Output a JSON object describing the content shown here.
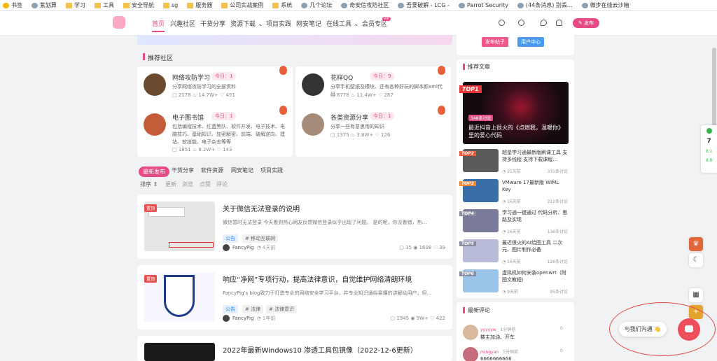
{
  "bookmarks": [
    {
      "icon": "star-icon",
      "label": "书签"
    },
    {
      "icon": "globe-icon",
      "label": "紫划算"
    },
    {
      "icon": "folder-icon",
      "label": "学习"
    },
    {
      "icon": "folder-icon",
      "label": "工具"
    },
    {
      "icon": "folder-icon",
      "label": "安全导航"
    },
    {
      "icon": "folder-icon",
      "label": "sg"
    },
    {
      "icon": "folder-icon",
      "label": "服务器"
    },
    {
      "icon": "folder-icon",
      "label": "公司实战案例"
    },
    {
      "icon": "folder-icon",
      "label": "系统"
    },
    {
      "icon": "globe-icon",
      "label": "几个论坛"
    },
    {
      "icon": "globe-icon",
      "label": "奇安信攻防社区"
    },
    {
      "icon": "globe-icon",
      "label": "吾爱破解 - LCG -"
    },
    {
      "icon": "globe-icon",
      "label": "Parrot Security"
    },
    {
      "icon": "globe-icon",
      "label": "(44条消息) 别丢..."
    },
    {
      "icon": "globe-icon",
      "label": "微步在线云沙箱"
    }
  ],
  "nav": {
    "items": [
      "首页",
      "兴趣社区",
      "干货分享",
      "资源下载 ⌄",
      "项目实践",
      "网安笔记",
      "在线工具 ⌄",
      "会员专区"
    ],
    "vip_badge": "VIP",
    "publish": "✎ 发布"
  },
  "side_top": {
    "publish_post": "发布帖子",
    "user_center": "用户中心"
  },
  "community": {
    "title": "推荐社区",
    "cards": [
      {
        "name": "网络攻防学习",
        "today": "今日：1",
        "desc": "分享网络攻防学习的全部资料",
        "stats": "▢ 2178   ♨ 14.7W+   ♡ 451",
        "color": "#6b4a2f"
      },
      {
        "name": "花样QQ",
        "today": "今日：9",
        "desc": "分享手机壁纸及模块、还有各种好玩的脚本颜xml代码",
        "stats": "▢ 8778   ♨ 11.4W+   ♡ 287",
        "color": "#333"
      },
      {
        "name": "电子图书馆",
        "today": "今日：1",
        "desc": "包括编程技术、红蓝黑队、软件开发、电子技术、电脑技巧、基础知识、加密解密、前端、破解逆向、建站、软技能、电子杂志等等",
        "stats": "▢ 1851   ♨ 8.2W+   ♡ 143",
        "color": "#c45c3a"
      },
      {
        "name": "各类资源分享",
        "today": "今日：1",
        "desc": "分享一些有意思用的知识",
        "stats": "▢ 1375   ♨ 3.8W+   ♡ 126",
        "color": "#a58b7a"
      }
    ]
  },
  "tabs": [
    "最新发布",
    "干货分享",
    "软件资源",
    "网安笔记",
    "项目实践"
  ],
  "sort": [
    "排序 ⇕",
    "更新",
    "浏览",
    "点赞",
    "评论"
  ],
  "posts": [
    {
      "tag": "置顶",
      "title": "关于微信无法登录的说明",
      "excerpt": "微信暂时无法登录 今天看到热心网友反馈微信登录似乎出现了问题。 是的呢，你没看错，热…",
      "tags": [
        "公告",
        "# 移动互联网"
      ],
      "author": "FancyPig",
      "time": "◔ 4天前",
      "stats": "▢ 35   ◉ 1608   ♡ 39"
    },
    {
      "tag": "置顶",
      "title": "响应“净网”专项行动，提高法律意识，自觉维护网络清朗环境",
      "excerpt": "FancyPig's blog致力于打造专业的网络安全学习平台，并专业知识通俗易懂的讲解给用户，但…",
      "tags": [
        "公告",
        "# 法律",
        "# 法律意识"
      ],
      "author": "FancyPig",
      "time": "◔ 1年前",
      "stats": "▢ 1945   ◉ 9W+   ♡ 422"
    },
    {
      "tag": "",
      "title": "2022年最新Windows10 渗透工具包镜像（2022-12-6更新）",
      "excerpt": "",
      "tags": [],
      "author": "",
      "time": "",
      "stats": ""
    }
  ],
  "articles": {
    "title": "推荐文章",
    "top1": {
      "rank": "TOP1",
      "hot": "348条讨论",
      "title": "最近抖音上很火的《点燃我，温暖你》里的爱心代码"
    },
    "list": [
      {
        "rank": "TOP2",
        "title": "超星学习通最新版刷课工具 支持多线程 支持下载课程…",
        "time": "◔ 21天前",
        "views": "331条讨论",
        "color": "#e85a3a",
        "img": "#5a5a5a"
      },
      {
        "rank": "TOP3",
        "title": "VMware 17最新版 WIML Key",
        "time": "◔ 16天前",
        "views": "212条讨论",
        "color": "#f0893a",
        "img": "#3a6ea8"
      },
      {
        "rank": "TOP4",
        "title": "学习通一键通过 代码分析、思路及实现",
        "time": "◔ 16天前",
        "views": "136条讨论",
        "color": "#8a8ea0",
        "img": "#7a7a9a"
      },
      {
        "rank": "TOP5",
        "title": "最近很火的AI绘图工具 二次元、图片制作必备",
        "time": "◔ 16天前",
        "views": "126条讨论",
        "color": "#8a8ea0",
        "img": "#b8bcd8"
      },
      {
        "rank": "TOP6",
        "title": "虚拟机如何安装openwrt（附图文教程）",
        "time": "◔ 9天前",
        "views": "95条讨论",
        "color": "#8a8ea0",
        "img": "#9ac4e8"
      }
    ]
  },
  "comments": {
    "title": "最新评论",
    "list": [
      {
        "name": "yyyyyw",
        "time": "1分钟前",
        "text": "楼主加油、开车",
        "likes": "0"
      },
      {
        "name": "mingyan",
        "time": "5分钟前",
        "text": "6666666666",
        "likes": "0"
      }
    ]
  },
  "chat": {
    "label": "与我们沟通 👋"
  },
  "extension": {
    "badge": "7",
    "line1": "0.1",
    "line2": "0.0"
  }
}
